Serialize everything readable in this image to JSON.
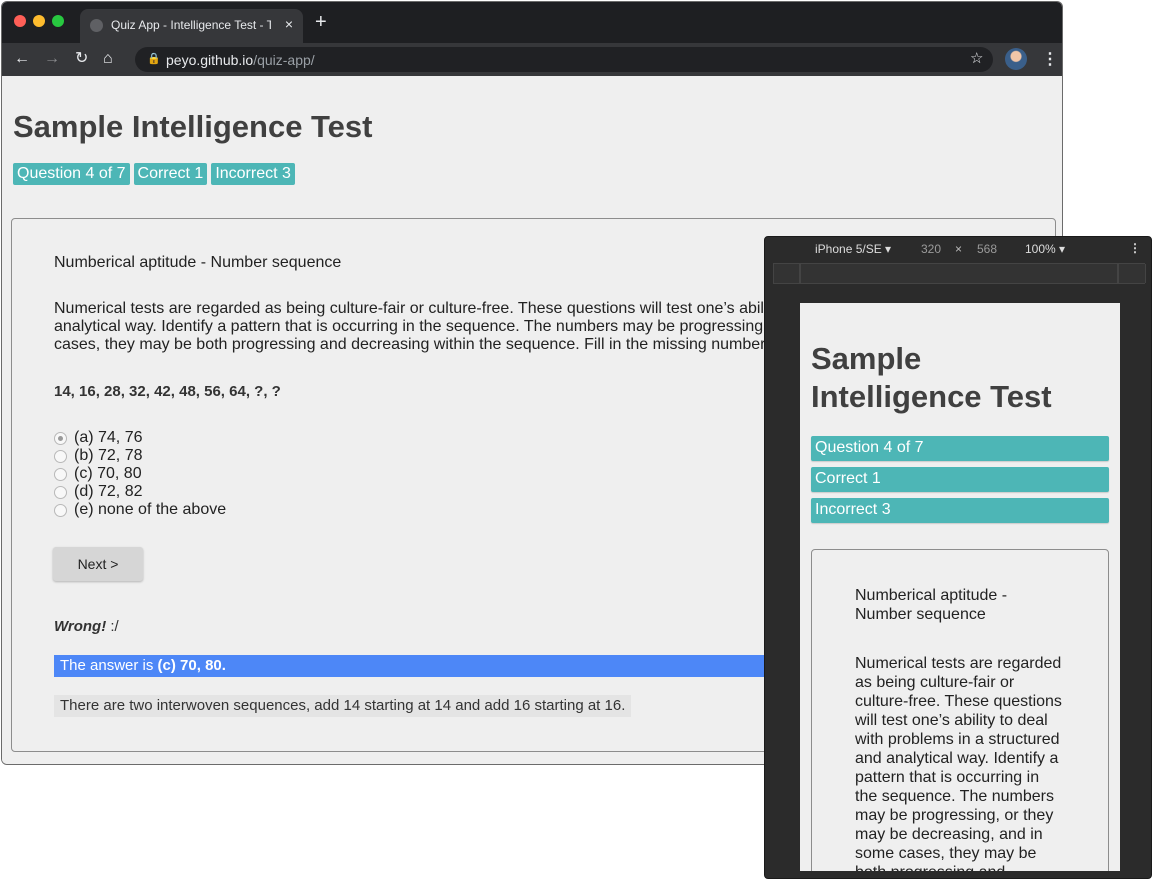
{
  "browser": {
    "tab_title": "Quiz App - Intelligence Test - T",
    "tab_close": "×",
    "new_tab": "+",
    "url_host": "peyo.github.io",
    "url_path": "/quiz-app/"
  },
  "quiz": {
    "title": "Sample Intelligence Test",
    "badges": {
      "question": "Question 4 of 7",
      "correct": "Correct 1",
      "incorrect": "Incorrect 3"
    },
    "category": "Numberical aptitude - Number sequence",
    "description": "Numerical tests are regarded as being culture-fair or culture-free. These questions will test one’s ability to d\nanalytical way. Identify a pattern that is occurring in the sequence. The numbers may be progressing, or the\ncases, they may be both progressing and decreasing within the sequence. Fill in the missing number(s) inc",
    "sequence": "14, 16, 28, 32, 42, 48, 56, 64, ?, ?",
    "options": [
      "(a) 74, 76",
      "(b) 72, 78",
      "(c) 70, 80",
      "(d) 72, 82",
      "(e) none of the above"
    ],
    "selected_option": "(a) 74, 76",
    "next_label": "Next >",
    "result_strong": "Wrong!",
    "result_rest": " :/",
    "answer_prefix": "The answer is ",
    "answer_value": "(c) 70, 80.",
    "explanation": "There are two interwoven sequences, add 14 starting at 14 and add 16 starting at 16."
  },
  "devtools": {
    "device": "iPhone 5/SE ▾",
    "width": "320",
    "times": "×",
    "height": "568",
    "zoom": "100% ▾",
    "more": "⋮"
  },
  "mobile": {
    "title": "Sample\nIntelligence Test",
    "category": "Numberical aptitude -\nNumber sequence",
    "description": "Numerical tests are regarded\nas being culture-fair or\nculture-free. These questions\nwill test one’s ability to deal\nwith problems in a structured\nand analytical way. Identify a\npattern that is occurring in\nthe sequence. The numbers\nmay be progressing, or they\nmay be decreasing, and in\nsome cases, they may be\nboth progressing and"
  },
  "icons": {
    "back": "←",
    "forward": "→",
    "reload": "↻",
    "home": "⌂",
    "lock": "🔒",
    "star": "☆",
    "menu": "⋮"
  },
  "colors": {
    "badge_teal": "#4db6b6",
    "answer_blue": "#4d87f7",
    "page_bg": "#efefef"
  }
}
